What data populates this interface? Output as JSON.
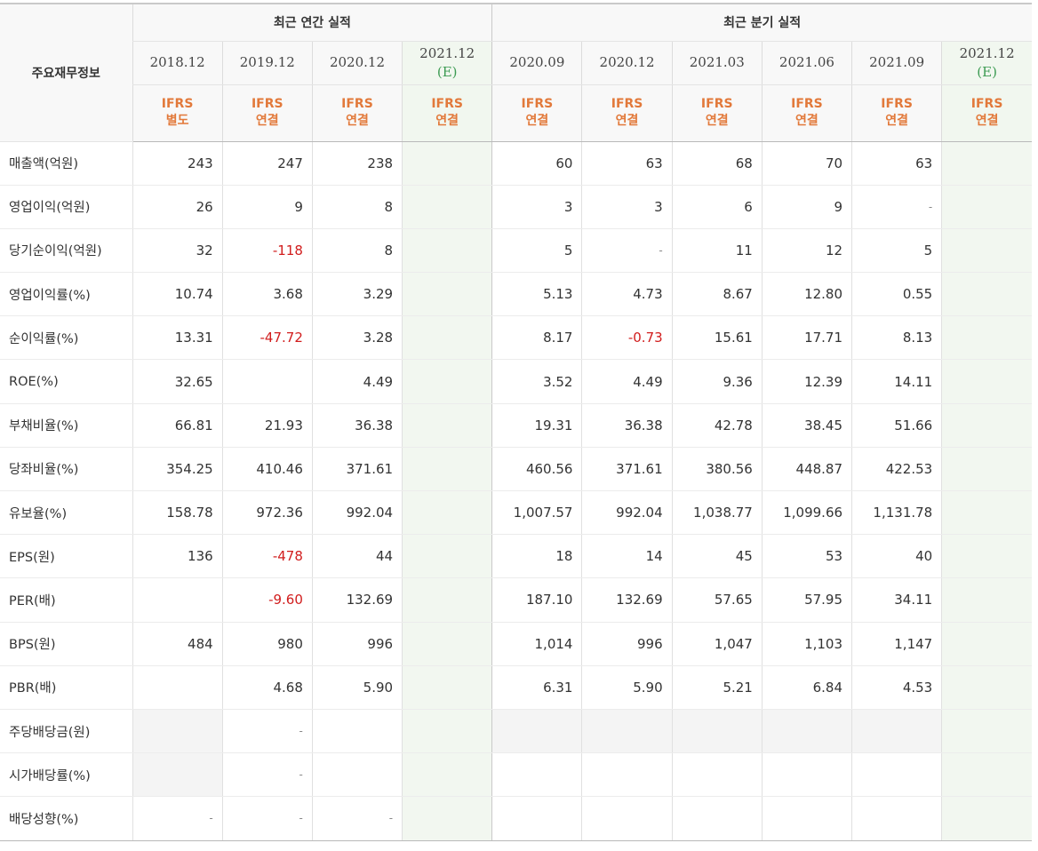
{
  "header": {
    "label": "주요재무정보",
    "annual_title": "최근 연간 실적",
    "quarterly_title": "최근 분기 실적",
    "periods": [
      {
        "date": "2018.12",
        "est": "",
        "ifrs": "IFRS",
        "basis": "별도",
        "is_estimate": false
      },
      {
        "date": "2019.12",
        "est": "",
        "ifrs": "IFRS",
        "basis": "연결",
        "is_estimate": false
      },
      {
        "date": "2020.12",
        "est": "",
        "ifrs": "IFRS",
        "basis": "연결",
        "is_estimate": false
      },
      {
        "date": "2021.12",
        "est": "(E)",
        "ifrs": "IFRS",
        "basis": "연결",
        "is_estimate": true
      },
      {
        "date": "2020.09",
        "est": "",
        "ifrs": "IFRS",
        "basis": "연결",
        "is_estimate": false
      },
      {
        "date": "2020.12",
        "est": "",
        "ifrs": "IFRS",
        "basis": "연결",
        "is_estimate": false
      },
      {
        "date": "2021.03",
        "est": "",
        "ifrs": "IFRS",
        "basis": "연결",
        "is_estimate": false
      },
      {
        "date": "2021.06",
        "est": "",
        "ifrs": "IFRS",
        "basis": "연결",
        "is_estimate": false
      },
      {
        "date": "2021.09",
        "est": "",
        "ifrs": "IFRS",
        "basis": "연결",
        "is_estimate": false
      },
      {
        "date": "2021.12",
        "est": "(E)",
        "ifrs": "IFRS",
        "basis": "연결",
        "is_estimate": true
      }
    ]
  },
  "colors": {
    "negative": "#d11d1d",
    "ifrs": "#e2793a",
    "estimate": "#3c9b52"
  },
  "rows": [
    {
      "label": "매출액(억원)",
      "values": [
        "243",
        "247",
        "238",
        "",
        "60",
        "63",
        "68",
        "70",
        "63",
        ""
      ],
      "grey": [],
      "group_start": false
    },
    {
      "label": "영업이익(억원)",
      "values": [
        "26",
        "9",
        "8",
        "",
        "3",
        "3",
        "6",
        "9",
        "-",
        ""
      ],
      "grey": [],
      "group_start": false
    },
    {
      "label": "당기순이익(억원)",
      "values": [
        "32",
        "-118",
        "8",
        "",
        "5",
        "-",
        "11",
        "12",
        "5",
        ""
      ],
      "grey": [],
      "group_start": false
    },
    {
      "label": "영업이익률(%)",
      "values": [
        "10.74",
        "3.68",
        "3.29",
        "",
        "5.13",
        "4.73",
        "8.67",
        "12.80",
        "0.55",
        ""
      ],
      "grey": [],
      "group_start": true
    },
    {
      "label": "순이익률(%)",
      "values": [
        "13.31",
        "-47.72",
        "3.28",
        "",
        "8.17",
        "-0.73",
        "15.61",
        "17.71",
        "8.13",
        ""
      ],
      "grey": [],
      "group_start": false
    },
    {
      "label": "ROE(%)",
      "values": [
        "32.65",
        "",
        "4.49",
        "",
        "3.52",
        "4.49",
        "9.36",
        "12.39",
        "14.11",
        ""
      ],
      "grey": [],
      "group_start": false
    },
    {
      "label": "부채비율(%)",
      "values": [
        "66.81",
        "21.93",
        "36.38",
        "",
        "19.31",
        "36.38",
        "42.78",
        "38.45",
        "51.66",
        ""
      ],
      "grey": [],
      "group_start": true
    },
    {
      "label": "당좌비율(%)",
      "values": [
        "354.25",
        "410.46",
        "371.61",
        "",
        "460.56",
        "371.61",
        "380.56",
        "448.87",
        "422.53",
        ""
      ],
      "grey": [],
      "group_start": false
    },
    {
      "label": "유보율(%)",
      "values": [
        "158.78",
        "972.36",
        "992.04",
        "",
        "1,007.57",
        "992.04",
        "1,038.77",
        "1,099.66",
        "1,131.78",
        ""
      ],
      "grey": [],
      "group_start": false
    },
    {
      "label": "EPS(원)",
      "values": [
        "136",
        "-478",
        "44",
        "",
        "18",
        "14",
        "45",
        "53",
        "40",
        ""
      ],
      "grey": [],
      "group_start": true
    },
    {
      "label": "PER(배)",
      "values": [
        "",
        "-9.60",
        "132.69",
        "",
        "187.10",
        "132.69",
        "57.65",
        "57.95",
        "34.11",
        ""
      ],
      "grey": [],
      "group_start": false
    },
    {
      "label": "BPS(원)",
      "values": [
        "484",
        "980",
        "996",
        "",
        "1,014",
        "996",
        "1,047",
        "1,103",
        "1,147",
        ""
      ],
      "grey": [],
      "group_start": false
    },
    {
      "label": "PBR(배)",
      "values": [
        "",
        "4.68",
        "5.90",
        "",
        "6.31",
        "5.90",
        "5.21",
        "6.84",
        "4.53",
        ""
      ],
      "grey": [],
      "group_start": false
    },
    {
      "label": "주당배당금(원)",
      "values": [
        "",
        "-",
        "",
        "",
        "",
        "",
        "",
        "",
        "",
        ""
      ],
      "grey": [
        0,
        4,
        5,
        6,
        7,
        8
      ],
      "group_start": true
    },
    {
      "label": "시가배당률(%)",
      "values": [
        "",
        "-",
        "",
        "",
        "",
        "",
        "",
        "",
        "",
        ""
      ],
      "grey": [
        0
      ],
      "group_start": false
    },
    {
      "label": "배당성향(%)",
      "values": [
        "-",
        "-",
        "-",
        "",
        "",
        "",
        "",
        "",
        "",
        ""
      ],
      "grey": [],
      "group_start": false
    }
  ]
}
